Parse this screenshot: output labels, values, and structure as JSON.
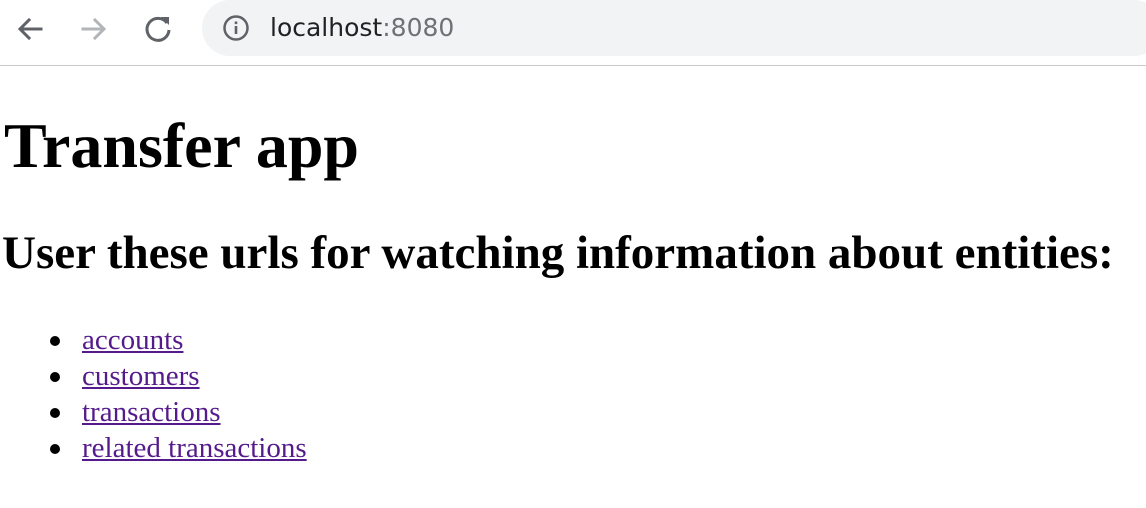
{
  "browser": {
    "url_host": "localhost",
    "url_port": ":8080",
    "icons": {
      "back": "arrow-left-icon",
      "forward": "arrow-right-icon",
      "reload": "reload-icon",
      "info": "info-icon"
    }
  },
  "page": {
    "title": "Transfer app",
    "subtitle": "User these urls for watching information about entities:",
    "links": [
      {
        "label": "accounts"
      },
      {
        "label": "customers"
      },
      {
        "label": "transactions"
      },
      {
        "label": "related transactions"
      }
    ],
    "colors": {
      "link_visited": "#551a8b",
      "omnibox_bg": "#f1f3f4"
    }
  }
}
